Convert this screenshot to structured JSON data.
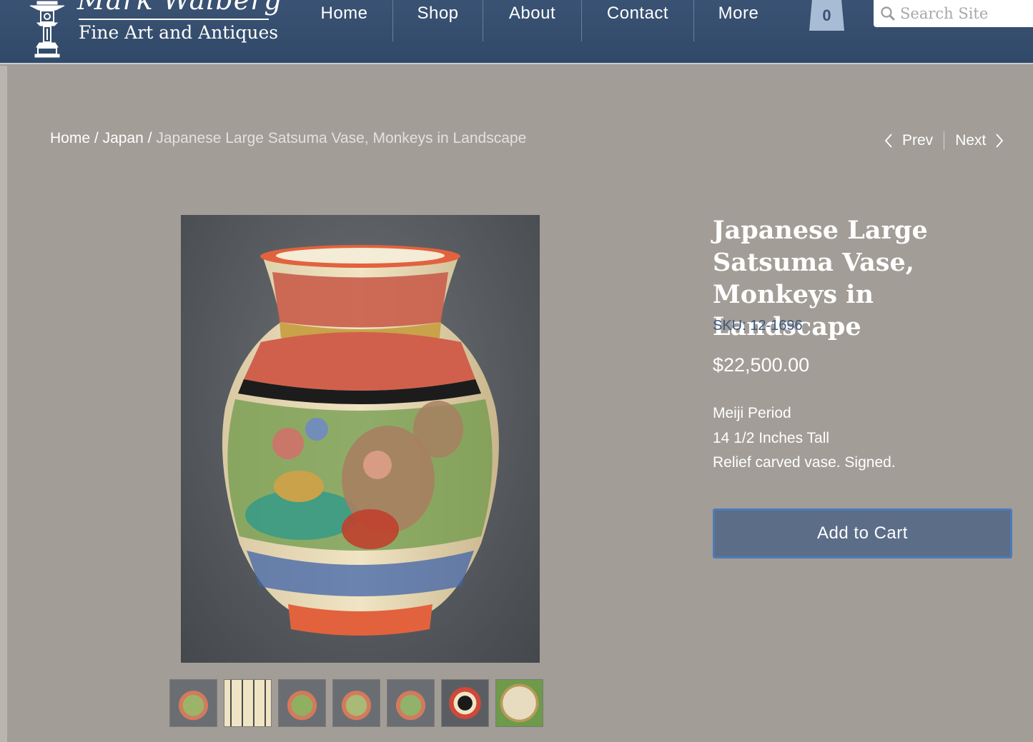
{
  "header": {
    "logo_name": "Mark Walberg",
    "logo_tagline": "Fine Art and Antiques",
    "nav": [
      "Home",
      "Shop",
      "About",
      "Contact",
      "More"
    ],
    "cart_count": "0",
    "search_placeholder": "Search Site",
    "colors": {
      "bar": "#324a69",
      "cart": "#a9bcd6"
    }
  },
  "breadcrumb": {
    "home": "Home",
    "sep1": "/",
    "category": "Japan",
    "sep2": "/",
    "current": "Japanese Large Satsuma Vase, Monkeys in Landscape"
  },
  "pager": {
    "prev": "Prev",
    "next": "Next"
  },
  "product": {
    "title": "Japanese Large Satsuma Vase, Monkeys in Landscape",
    "sku": "SKU: 12-1696",
    "price": "$22,500.00",
    "description": [
      "Meiji Period",
      "14 1/2 Inches Tall",
      "Relief carved vase. Signed."
    ],
    "add_to_cart": "Add to Cart",
    "thumbnail_count": 7
  },
  "icons": [
    "logo-lantern-icon",
    "search-icon",
    "chevron-left-icon",
    "chevron-right-icon"
  ],
  "colors": {
    "page_bg": "#a29d97",
    "sku": "#3d5a80",
    "button": "#5c6d88",
    "button_border": "#4c7bb8"
  }
}
